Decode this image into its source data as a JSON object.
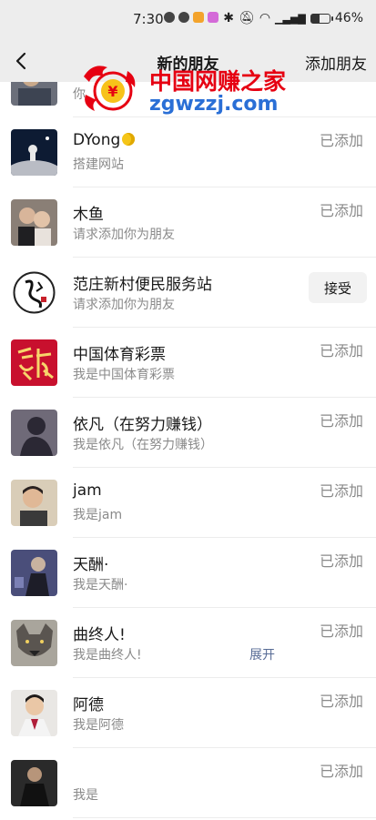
{
  "status_bar": {
    "time": "7:30",
    "battery_percent": "46%",
    "battery_level": 0.46
  },
  "nav": {
    "title": "新的朋友",
    "add_friend": "添加朋友"
  },
  "watermark": {
    "line1": "中国网赚之家",
    "line2": "zgwzzj.com"
  },
  "colors": {
    "accent": "#576b95",
    "watermark_red": "#e60012",
    "watermark_blue": "#2a6fd6"
  },
  "friends": [
    {
      "name": "",
      "message": "你",
      "status": "",
      "avatar": "avatar-person"
    },
    {
      "name": "DYong",
      "message": "搭建网站",
      "status": "已添加",
      "avatar": "avatar-moon-astronaut"
    },
    {
      "name": "木鱼",
      "message": "请求添加你为朋友",
      "status": "已添加",
      "avatar": "avatar-couple"
    },
    {
      "name": "范庄新村便民服务站",
      "message": "请求添加你为朋友",
      "action": "接受",
      "avatar": "avatar-logo-seal"
    },
    {
      "name": "中国体育彩票",
      "message": "我是中国体育彩票",
      "status": "已添加",
      "avatar": "avatar-red-character"
    },
    {
      "name": "依凡（在努力赚钱）",
      "message": "我是依凡（在努力赚钱）",
      "status": "已添加",
      "avatar": "avatar-silhouette"
    },
    {
      "name": "jam",
      "message": "我是jam",
      "status": "已添加",
      "avatar": "avatar-person"
    },
    {
      "name": "天酬·",
      "message": "我是天酬·",
      "status": "已添加",
      "avatar": "avatar-dark-portrait"
    },
    {
      "name": "曲终人!",
      "message": "我是曲终人!",
      "status": "已添加",
      "expand": "展开",
      "avatar": "avatar-wolf"
    },
    {
      "name": "阿德",
      "message": "我是阿德",
      "status": "已添加",
      "avatar": "avatar-man-suit"
    },
    {
      "name": "",
      "message": "我是",
      "status": "已添加",
      "avatar": "avatar-black-jacket"
    }
  ]
}
